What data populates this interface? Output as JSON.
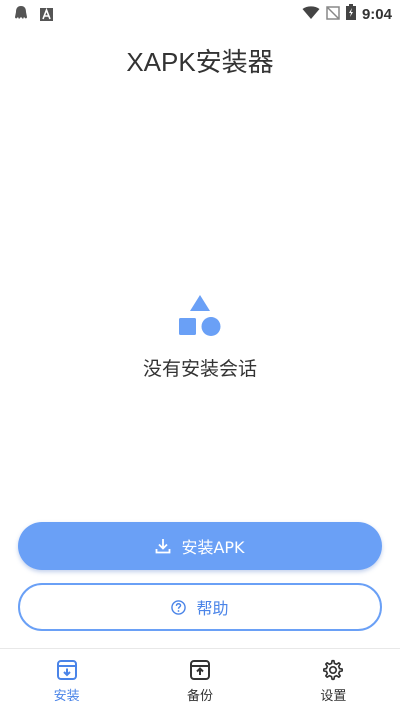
{
  "status_bar": {
    "time": "9:04",
    "left_icons": [
      "notification-ghost-icon",
      "font-a-icon"
    ],
    "right_icons": [
      "wifi-icon",
      "no-signal-icon",
      "battery-charging-icon"
    ]
  },
  "header": {
    "title": "XAPK安装器"
  },
  "empty_state": {
    "icon": "shapes-icon",
    "message": "没有安装会话"
  },
  "actions": {
    "install_apk": {
      "label": "安装APK",
      "icon": "download-icon"
    },
    "help": {
      "label": "帮助",
      "icon": "question-circle-icon"
    }
  },
  "bottom_nav": {
    "items": [
      {
        "label": "安装",
        "icon": "install-box-icon",
        "active": true
      },
      {
        "label": "备份",
        "icon": "backup-box-icon",
        "active": false
      },
      {
        "label": "设置",
        "icon": "gear-icon",
        "active": false
      }
    ]
  },
  "colors": {
    "accent": "#6aa0f6",
    "accent_text": "#4a84e8",
    "text": "#333333",
    "background": "#ffffff"
  }
}
